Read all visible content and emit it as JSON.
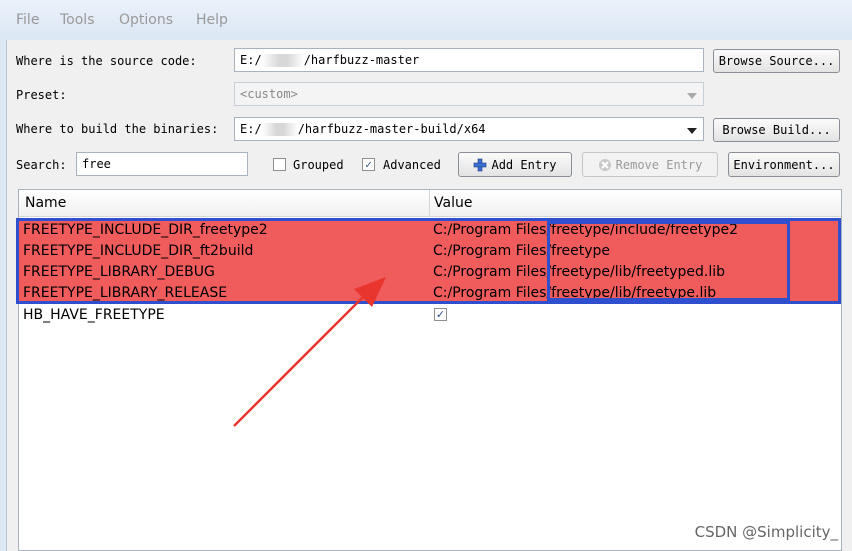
{
  "menu": [
    "File",
    "Tools",
    "Options",
    "Help"
  ],
  "source": {
    "label": "Where is the source code:",
    "prefix": "E:/",
    "suffix": "/harfbuzz-master",
    "button": "Browse Source..."
  },
  "preset": {
    "label": "Preset:",
    "value": "<custom>"
  },
  "build": {
    "label": "Where to build the binaries:",
    "prefix": "E:/",
    "suffix": "/harfbuzz-master-build/x64",
    "button": "Browse Build..."
  },
  "search": {
    "label": "Search:",
    "value": "free"
  },
  "options": {
    "grouped_label": "Grouped",
    "grouped_checked": false,
    "advanced_label": "Advanced",
    "advanced_checked": true
  },
  "buttons": {
    "add_entry": "Add Entry",
    "remove_entry": "Remove Entry",
    "environment": "Environment..."
  },
  "table": {
    "headers": [
      "Name",
      "Value"
    ],
    "rows": [
      {
        "name": "FREETYPE_INCLUDE_DIR_freetype2",
        "value": "C:/Program Files/freetype/include/freetype2"
      },
      {
        "name": "FREETYPE_INCLUDE_DIR_ft2build",
        "value": "C:/Program Files/freetype"
      },
      {
        "name": "FREETYPE_LIBRARY_DEBUG",
        "value": "C:/Program Files/freetype/lib/freetyped.lib"
      },
      {
        "name": "FREETYPE_LIBRARY_RELEASE",
        "value": "C:/Program Files/freetype/lib/freetype.lib"
      },
      {
        "name": "HB_HAVE_FREETYPE",
        "value": "",
        "checked": true
      }
    ]
  },
  "colors": {
    "highlight": "#f05c5c",
    "annotation_box": "#2f4fcf",
    "arrow": "#e8362f"
  },
  "watermark": "CSDN @Simplicity_"
}
